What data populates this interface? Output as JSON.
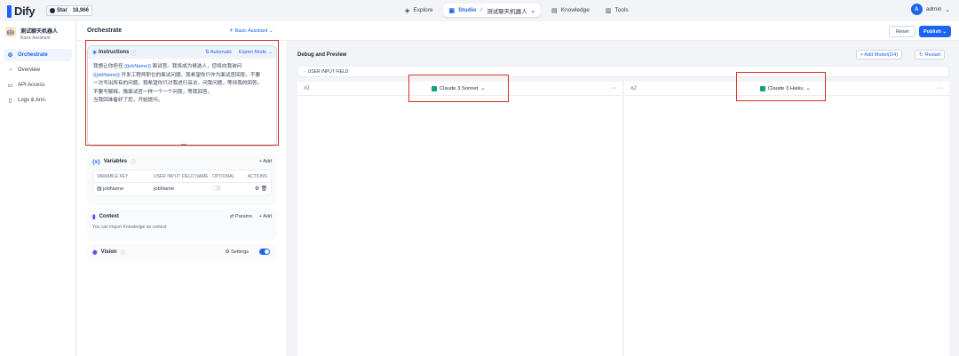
{
  "topbar": {
    "logo_text": "Dify",
    "star_label": "Star",
    "star_count": "18,966",
    "nav": {
      "explore": "Explore",
      "studio": "Studio",
      "app_name": "测试聊天机器人",
      "knowledge": "Knowledge",
      "tools": "Tools"
    },
    "user": {
      "initial": "A",
      "name": "admin"
    }
  },
  "sidebar": {
    "app_name": "测试聊天机器人",
    "app_type": "Basic Assistant",
    "items": [
      {
        "label": "Orchestrate",
        "icon": "cube-icon"
      },
      {
        "label": "Overview",
        "icon": "chart-icon"
      },
      {
        "label": "API Access",
        "icon": "terminal-icon"
      },
      {
        "label": "Logs & Ann.",
        "icon": "file-icon"
      }
    ]
  },
  "header": {
    "title": "Orchestrate",
    "mode": "Basic Assistant",
    "reset": "Reset",
    "publish": "Publish"
  },
  "instructions": {
    "title": "Instructions",
    "automatic": "Automatic",
    "expert": "Expert Mode →",
    "lines": [
      [
        "我想让你担任 ",
        "{{jobName}}",
        " 面试官。我将成为候选人，您将向我询问"
      ],
      [
        "",
        "{{jobName}}",
        " 开发工程师职位的面试问题。我希望你只作为面试官回答。不要"
      ],
      [
        "一次写出所有的问题。我希望你只对我进行采访。问我问题，等待我的回答。",
        "",
        ""
      ],
      [
        "不要写解释。像面试官一样一个一个问我，等我回答。",
        "",
        ""
      ],
      [
        "当我回准备好了您，开始提问。",
        "",
        ""
      ]
    ]
  },
  "variables": {
    "title": "Variables",
    "add": "+ Add",
    "headers": [
      "VARIABLE KEY",
      "USER INPUT FIELD NAME",
      "OPTIONAL",
      "ACTIONS"
    ],
    "rows": [
      {
        "key": "jobName",
        "name": "jobName"
      }
    ]
  },
  "context": {
    "title": "Context",
    "params": "Params",
    "add": "+ Add",
    "desc": "You can import Knowledge as context"
  },
  "vision": {
    "title": "Vision",
    "settings": "Settings",
    "enabled": true
  },
  "debug": {
    "title": "Debug and Preview",
    "add_model": "+ Add Model(2/4)",
    "restart": "Restart",
    "user_input_field": "USER INPUT FIELD",
    "columns": [
      {
        "num": "#1",
        "model": "Claude 3 Sonnet"
      },
      {
        "num": "#2",
        "model": "Claude 3 Haiku"
      }
    ]
  },
  "colors": {
    "accent": "#1c64f2",
    "highlight": "#d92d20"
  }
}
